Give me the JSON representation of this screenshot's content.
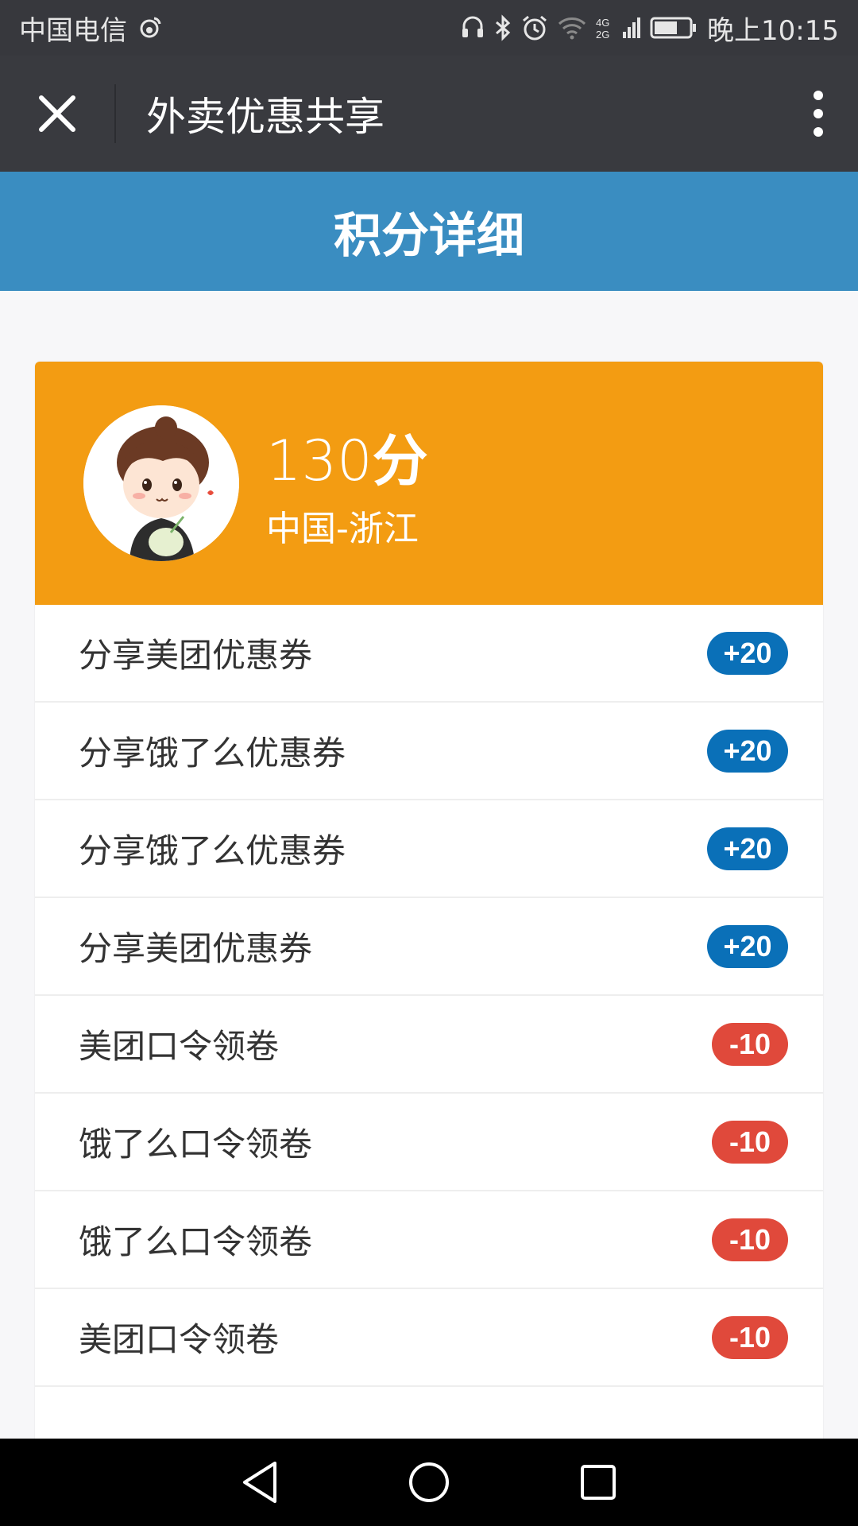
{
  "status_bar": {
    "carrier": "中国电信",
    "time": "晚上10:15",
    "network": "4G"
  },
  "title_bar": {
    "title": "外卖优惠共享"
  },
  "page_header": {
    "title": "积分详细"
  },
  "profile": {
    "score_value": "130",
    "score_unit": "分",
    "location": "中国-浙江"
  },
  "records": [
    {
      "label": "分享美团优惠券",
      "points": "+20",
      "type": "plus"
    },
    {
      "label": "分享饿了么优惠券",
      "points": "+20",
      "type": "plus"
    },
    {
      "label": "分享饿了么优惠券",
      "points": "+20",
      "type": "plus"
    },
    {
      "label": "分享美团优惠券",
      "points": "+20",
      "type": "plus"
    },
    {
      "label": "美团口令领卷",
      "points": "-10",
      "type": "minus"
    },
    {
      "label": "饿了么口令领卷",
      "points": "-10",
      "type": "minus"
    },
    {
      "label": "饿了么口令领卷",
      "points": "-10",
      "type": "minus"
    },
    {
      "label": "美团口令领卷",
      "points": "-10",
      "type": "minus"
    }
  ],
  "colors": {
    "header_blue": "#3a8dc1",
    "profile_orange": "#f39c12",
    "plus_badge": "#0a70b8",
    "minus_badge": "#e0493b"
  }
}
